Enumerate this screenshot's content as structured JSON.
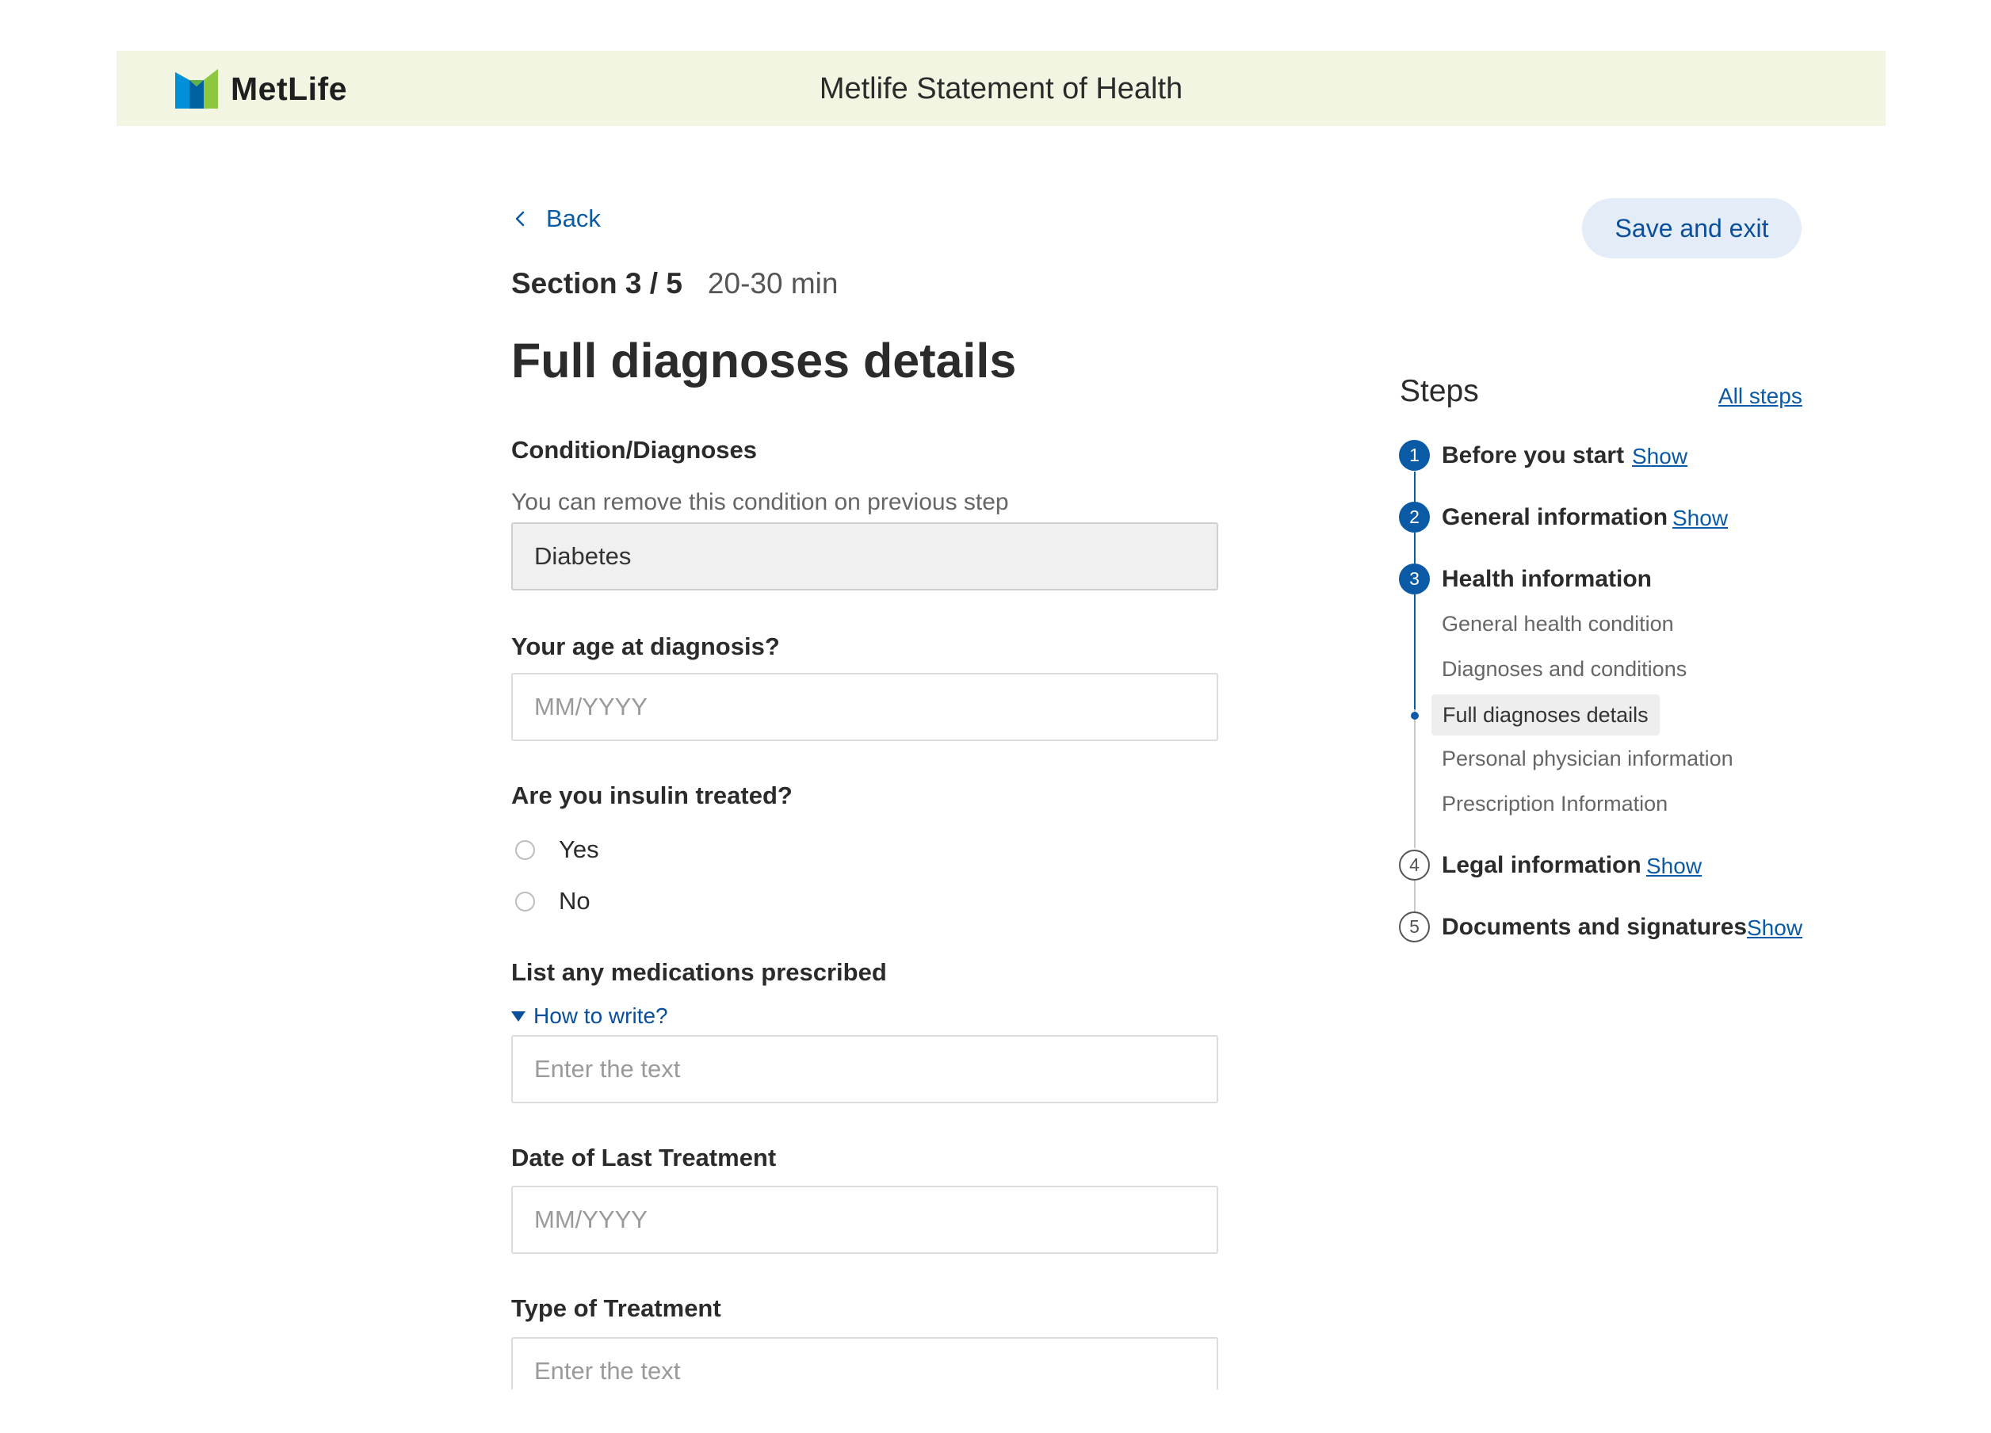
{
  "header": {
    "brand": "MetLife",
    "title": "Metlife Statement of Health",
    "colors": {
      "logo_green": "#8dc63f",
      "logo_blue": "#0090da",
      "logo_dark": "#0061a0"
    }
  },
  "nav": {
    "back_label": "Back",
    "save_exit_label": "Save and exit"
  },
  "section": {
    "number": "Section 3 / 5",
    "time": "20-30 min",
    "title": "Full diagnoses details"
  },
  "form": {
    "condition": {
      "label": "Condition/Diagnoses",
      "hint": "You can remove this condition on previous step",
      "value": "Diabetes"
    },
    "age": {
      "label": "Your age at diagnosis?",
      "placeholder": "MM/YYYY",
      "value": ""
    },
    "insulin": {
      "label": "Are you insulin treated?",
      "options": [
        "Yes",
        "No"
      ],
      "selected": null
    },
    "medications": {
      "label": "List any medications prescribed",
      "howto_label": "How to write?",
      "placeholder": "Enter the text",
      "value": ""
    },
    "last_treatment": {
      "label": "Date of Last Treatment",
      "placeholder": "MM/YYYY",
      "value": ""
    },
    "treatment_type": {
      "label": "Type of Treatment",
      "placeholder": "Enter the text",
      "value": ""
    }
  },
  "steps": {
    "title": "Steps",
    "all_steps_label": "All steps",
    "items": [
      {
        "number": "1",
        "label": "Before you start",
        "show_label": "Show",
        "status": "complete"
      },
      {
        "number": "2",
        "label": "General information",
        "show_label": "Show",
        "status": "complete"
      },
      {
        "number": "3",
        "label": "Health information",
        "status": "current",
        "sub_items": [
          "General health condition",
          "Diagnoses and conditions",
          "Full diagnoses details",
          "Personal physician information",
          "Prescription Information"
        ],
        "current_sub_item": "Full diagnoses details"
      },
      {
        "number": "4",
        "label": "Legal information",
        "show_label": "Show",
        "status": "upcoming"
      },
      {
        "number": "5",
        "label": "Documents and signatures",
        "show_label": "Show",
        "status": "upcoming"
      }
    ]
  }
}
